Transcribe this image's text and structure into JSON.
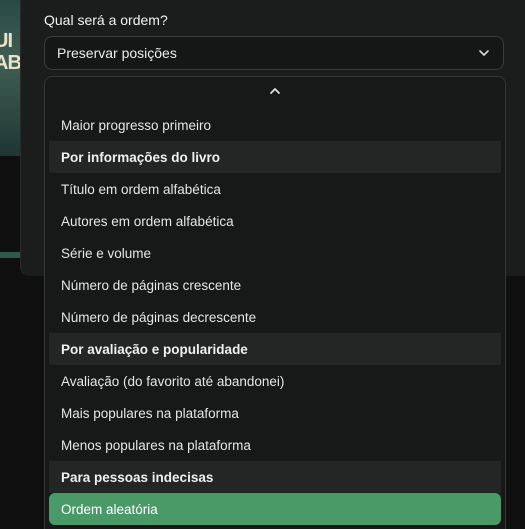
{
  "background": {
    "cover_text": "UI\nAB"
  },
  "form": {
    "question": "Qual será a ordem?",
    "selected_value": "Preservar posições"
  },
  "dropdown": {
    "items": [
      {
        "kind": "option",
        "label": "Maior progresso primeiro"
      },
      {
        "kind": "group",
        "label": "Por informações do livro"
      },
      {
        "kind": "option",
        "label": "Título em ordem alfabética"
      },
      {
        "kind": "option",
        "label": "Autores em ordem alfabética"
      },
      {
        "kind": "option",
        "label": "Série e volume"
      },
      {
        "kind": "option",
        "label": "Número de páginas crescente"
      },
      {
        "kind": "option",
        "label": "Número de páginas decrescente"
      },
      {
        "kind": "group",
        "label": "Por avaliação e popularidade"
      },
      {
        "kind": "option",
        "label": "Avaliação (do favorito até abandonei)"
      },
      {
        "kind": "option",
        "label": "Mais populares na plataforma"
      },
      {
        "kind": "option",
        "label": "Menos populares na plataforma"
      },
      {
        "kind": "group",
        "label": "Para pessoas indecisas"
      },
      {
        "kind": "option",
        "label": "Ordem aleatória",
        "highlighted": true
      }
    ]
  },
  "colors": {
    "accent": "#4a9a68",
    "group_bg": "#232624",
    "dropdown_bg": "#171918"
  }
}
